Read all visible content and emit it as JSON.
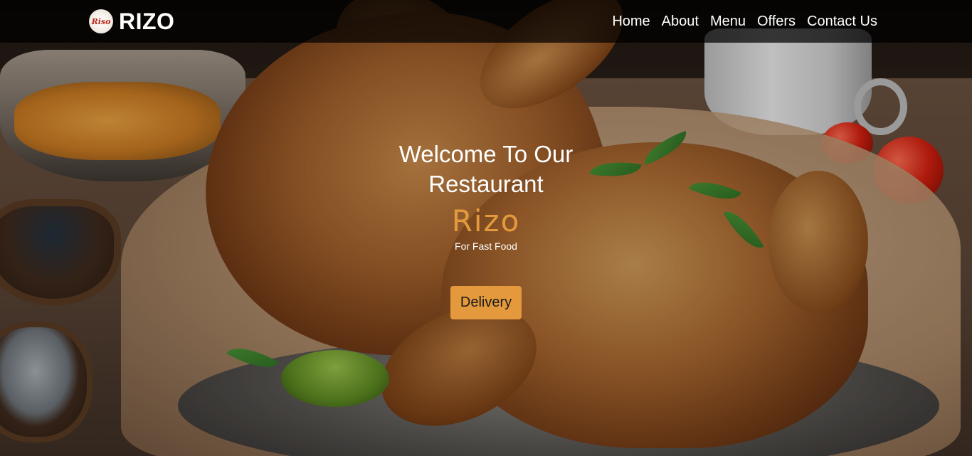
{
  "brand": {
    "logo_text": "Riso",
    "name": "RIZO"
  },
  "nav": {
    "items": [
      {
        "label": "Home"
      },
      {
        "label": "About"
      },
      {
        "label": "Menu"
      },
      {
        "label": "Offers"
      },
      {
        "label": "Contact Us"
      }
    ]
  },
  "hero": {
    "heading_line1": "Welcome To Our",
    "heading_line2": "Restaurant",
    "script_title": "Rizo",
    "tagline": "For Fast Food",
    "cta_label": "Delivery"
  },
  "colors": {
    "accent": "#e49a3c",
    "navbar_bg": "rgba(0,0,0,0.72)",
    "text": "#ffffff"
  },
  "icons": {
    "brand_logo": "riso-logo-icon"
  }
}
